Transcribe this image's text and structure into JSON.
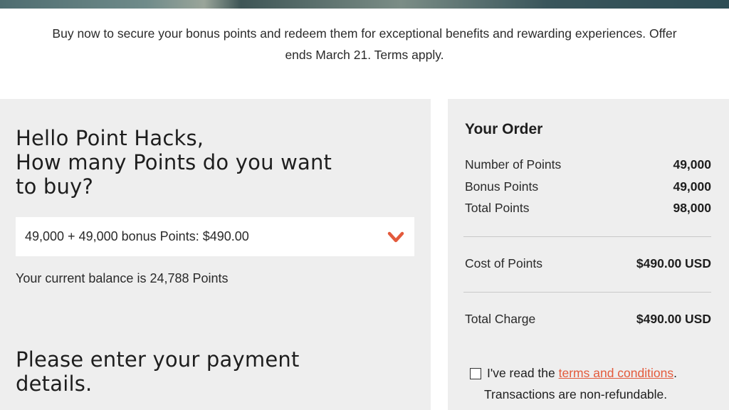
{
  "promo": {
    "line1": "Buy now to secure your bonus points and redeem them for exceptional benefits and rewarding experiences. Offer",
    "line2": "ends March 21. Terms apply."
  },
  "purchase": {
    "greeting": "Hello Point Hacks,",
    "question_line1": "How many Points do you want",
    "question_line2": "to buy?",
    "selected_option": "49,000 + 49,000 bonus Points: $490.00",
    "balance_text": "Your current balance is 24,788 Points",
    "payment_heading_line1": "Please enter your payment",
    "payment_heading_line2": "details."
  },
  "order": {
    "title": "Your Order",
    "number_label": "Number of Points",
    "number_value": "49,000",
    "bonus_label": "Bonus Points",
    "bonus_value": "49,000",
    "total_points_label": "Total Points",
    "total_points_value": "98,000",
    "cost_label": "Cost of Points",
    "cost_value": "$490.00 USD",
    "charge_label": "Total Charge",
    "charge_value": "$490.00 USD"
  },
  "terms": {
    "prefix": "I've read the ",
    "link_text": "terms and conditions",
    "suffix": ".",
    "note": "Transactions are non-refundable."
  },
  "colors": {
    "accent": "#e35a3c",
    "panel_bg": "#eeeeee"
  },
  "icons": {
    "dropdown": "chevron-down-icon"
  }
}
